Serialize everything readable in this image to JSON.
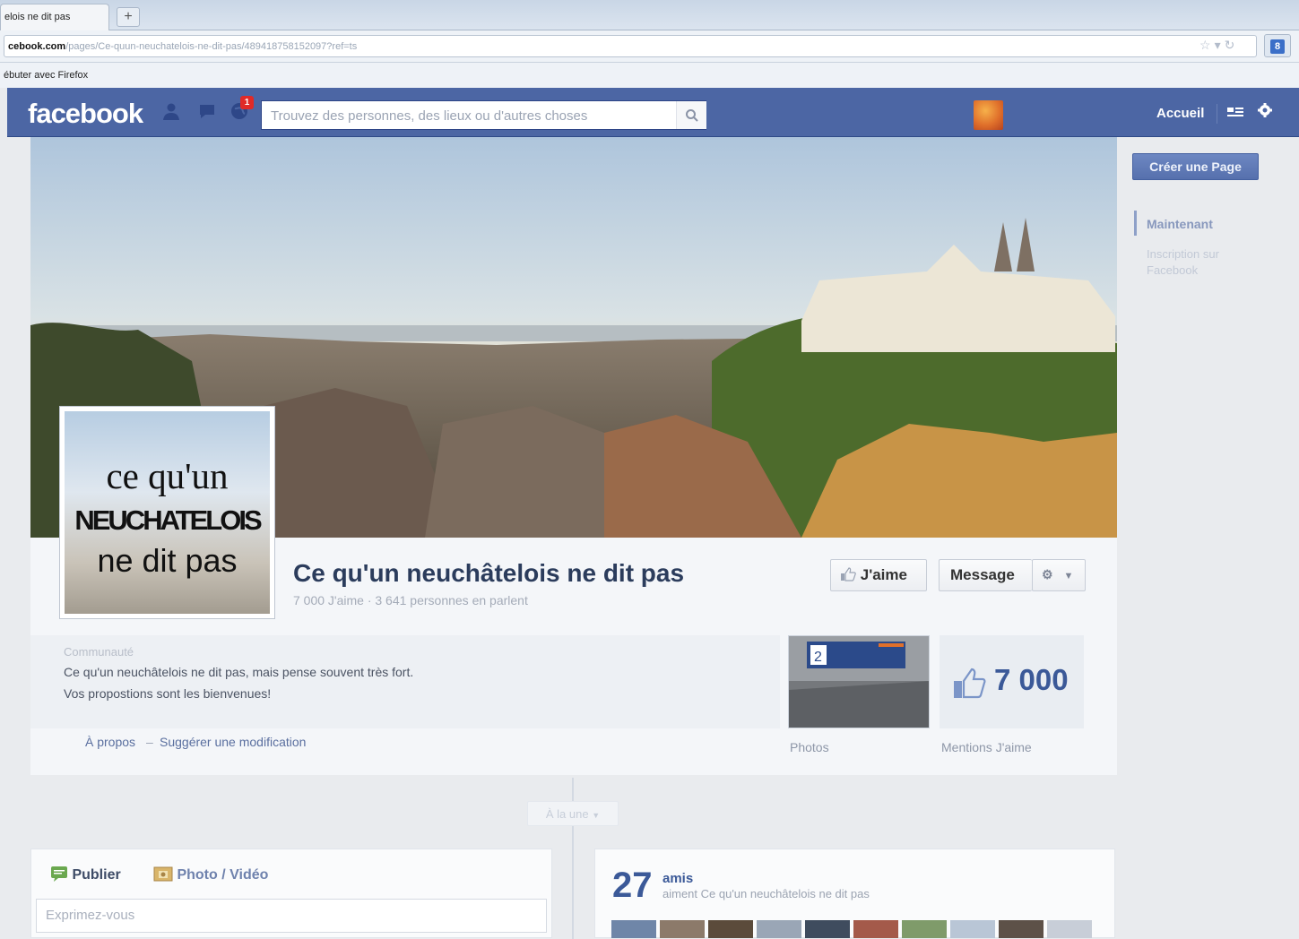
{
  "browser": {
    "tab_title": "elois ne dit pas",
    "new_tab_symbol": "+",
    "url_domain": "cebook.com",
    "url_rest": "/pages/Ce-quun-neuchatelois-ne-dit-pas/489418758152097?ref=ts",
    "bookmark": "ébuter avec Firefox"
  },
  "fb": {
    "logo": "facebook",
    "notification_count": "1",
    "search_placeholder": "Trouvez des personnes, des lieux ou d'autres choses",
    "nav_home": "Accueil"
  },
  "page": {
    "profile_lines": [
      "ce qu'un",
      "NEUCHATELOIS",
      "ne dit pas"
    ],
    "name": "Ce qu'un neuchâtelois ne dit pas",
    "subtitle": "7 000 J'aime · 3 641 personnes en parlent",
    "like_button": "J'aime",
    "message_button": "Message",
    "category": "Communauté",
    "description_1": "Ce qu'un neuchâtelois ne dit pas, mais pense souvent très fort.",
    "description_2": "Vos propostions sont les bienvenues!",
    "about_link": "À propos",
    "about_separator": "–",
    "suggest_link": "Suggérer une modification",
    "photos_label": "Photos",
    "likes_count": "7 000",
    "likes_label": "Mentions J'aime",
    "photo_sign_number": "2"
  },
  "sidebar": {
    "create_page": "Créer une Page",
    "timeline_now": "Maintenant",
    "timeline_join": "Inscription sur Facebook"
  },
  "timeline": {
    "filter": "À la une"
  },
  "composer": {
    "tab_publish": "Publier",
    "tab_photo": "Photo / Vidéo",
    "placeholder": "Exprimez-vous"
  },
  "friends": {
    "count": "27",
    "word": "amis",
    "subtitle": "aiment Ce qu'un neuchâtelois ne dit pas"
  },
  "colors": {
    "fb_blue": "#4c66a4",
    "link": "#3b5998"
  }
}
